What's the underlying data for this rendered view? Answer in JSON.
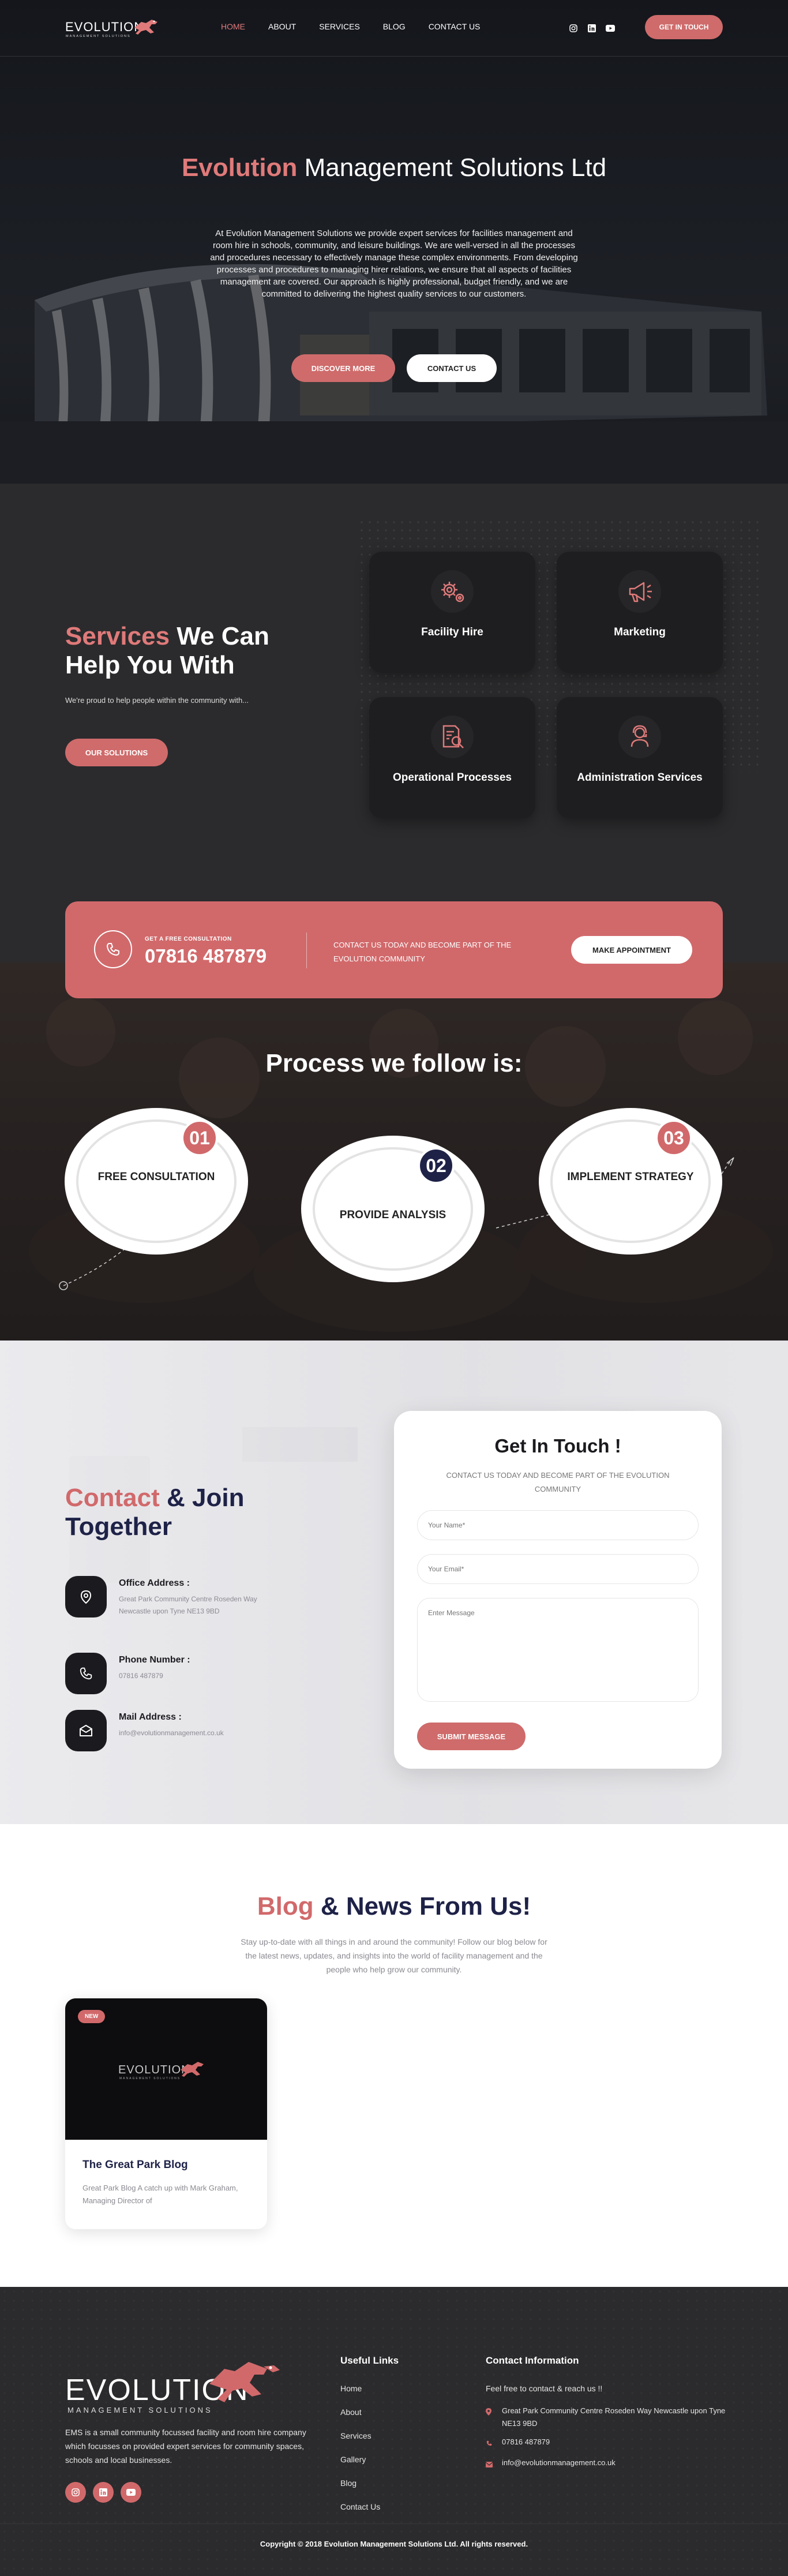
{
  "header": {
    "logo_text": "EVOLUTION",
    "logo_sub": "MANAGEMENT SOLUTIONS",
    "nav": [
      "HOME",
      "ABOUT",
      "SERVICES",
      "BLOG",
      "CONTACT US"
    ],
    "cta": "GET IN TOUCH",
    "social_icons": [
      "instagram-icon",
      "linkedin-icon",
      "youtube-icon"
    ]
  },
  "hero": {
    "title_accent": "Evolution",
    "title_rest": " Management Solutions Ltd",
    "text": "At Evolution Management Solutions we provide expert services for facilities management and room hire in schools, community, and leisure buildings. We are well-versed in all the processes and procedures necessary to effectively manage these complex environments. From developing processes and procedures to managing hirer relations, we ensure that all aspects of facilities management are covered. Our approach is highly professional, budget friendly, and we are committed to delivering the highest quality services to our customers.",
    "btn_discover": "DISCOVER MORE",
    "btn_contact": "CONTACT US"
  },
  "services": {
    "title_accent": "Services",
    "title_rest_1": " We Can",
    "title_rest_2": "Help You With",
    "desc": "We're proud to help people within the community with...",
    "btn": "OUR SOLUTIONS",
    "cards": [
      {
        "label": "Facility Hire",
        "icon": "gear-icon"
      },
      {
        "label": "Marketing",
        "icon": "megaphone-icon"
      },
      {
        "label": "Operational Processes",
        "icon": "document-search-icon"
      },
      {
        "label": "Administration Services",
        "icon": "support-agent-icon"
      }
    ]
  },
  "banner": {
    "free_label": "GET A FREE CONSULTATION",
    "phone": "07816 487879",
    "cta_text": "CONTACT US TODAY AND BECOME PART OF THE EVOLUTION COMMUNITY",
    "btn": "MAKE APPOINTMENT"
  },
  "process": {
    "title": "Process we follow is:",
    "steps": [
      {
        "num": "01",
        "label": "FREE CONSULTATION"
      },
      {
        "num": "02",
        "label": "PROVIDE ANALYSIS"
      },
      {
        "num": "03",
        "label": "IMPLEMENT STRATEGY"
      }
    ]
  },
  "contact": {
    "title_accent": "Contact",
    "title_rest_1": " & Join",
    "title_rest_2": "Together",
    "office_head": "Office Address :",
    "office_val": "Great Park Community Centre Roseden Way Newcastle upon Tyne NE13 9BD",
    "phone_head": "Phone Number :",
    "phone_val": "07816 487879",
    "mail_head": "Mail Address :",
    "mail_val": "info@evolutionmanagement.co.uk",
    "form": {
      "title": "Get In Touch !",
      "subtitle": "CONTACT US TODAY AND BECOME PART OF THE EVOLUTION COMMUNITY",
      "name_placeholder": "Your Name*",
      "email_placeholder": "Your Email*",
      "message_placeholder": "Enter Message",
      "submit": "SUBMIT MESSAGE"
    }
  },
  "blog": {
    "title_accent": "Blog",
    "title_rest": " & News From Us!",
    "subtitle": "Stay up-to-date with all things in and around the community! Follow our blog below for the latest news, updates, and insights into the world of facility management and the people who help grow our community.",
    "post": {
      "badge": "NEW",
      "thumb_logo": "EVOLUTION",
      "thumb_logo_sub": "MANAGEMENT SOLUTIONS",
      "title": "The Great Park Blog",
      "excerpt": "Great Park Blog A catch up with Mark Graham, Managing Director of"
    }
  },
  "footer": {
    "logo_text": "EVOLUTION",
    "logo_sub": "MANAGEMENT SOLUTIONS",
    "about": "EMS is a small community focussed facility and room hire company which focusses on provided expert services for community spaces, schools and local businesses.",
    "useful_title": "Useful Links",
    "links": [
      "Home",
      "About",
      "Services",
      "Gallery",
      "Blog",
      "Contact Us"
    ],
    "contact_title": "Contact Information",
    "contact_intro": "Feel free to contact & reach us !!",
    "address": "Great Park Community Centre Roseden Way Newcastle upon Tyne NE13 9BD",
    "phone": "07816 487879",
    "email": "info@evolutionmanagement.co.uk",
    "copyright": "Copyright © 2018 Evolution Management Solutions Ltd. All rights reserved."
  },
  "colors": {
    "accent": "#d1696b",
    "navy": "#1e2247",
    "dark": "#2b2b2d"
  }
}
